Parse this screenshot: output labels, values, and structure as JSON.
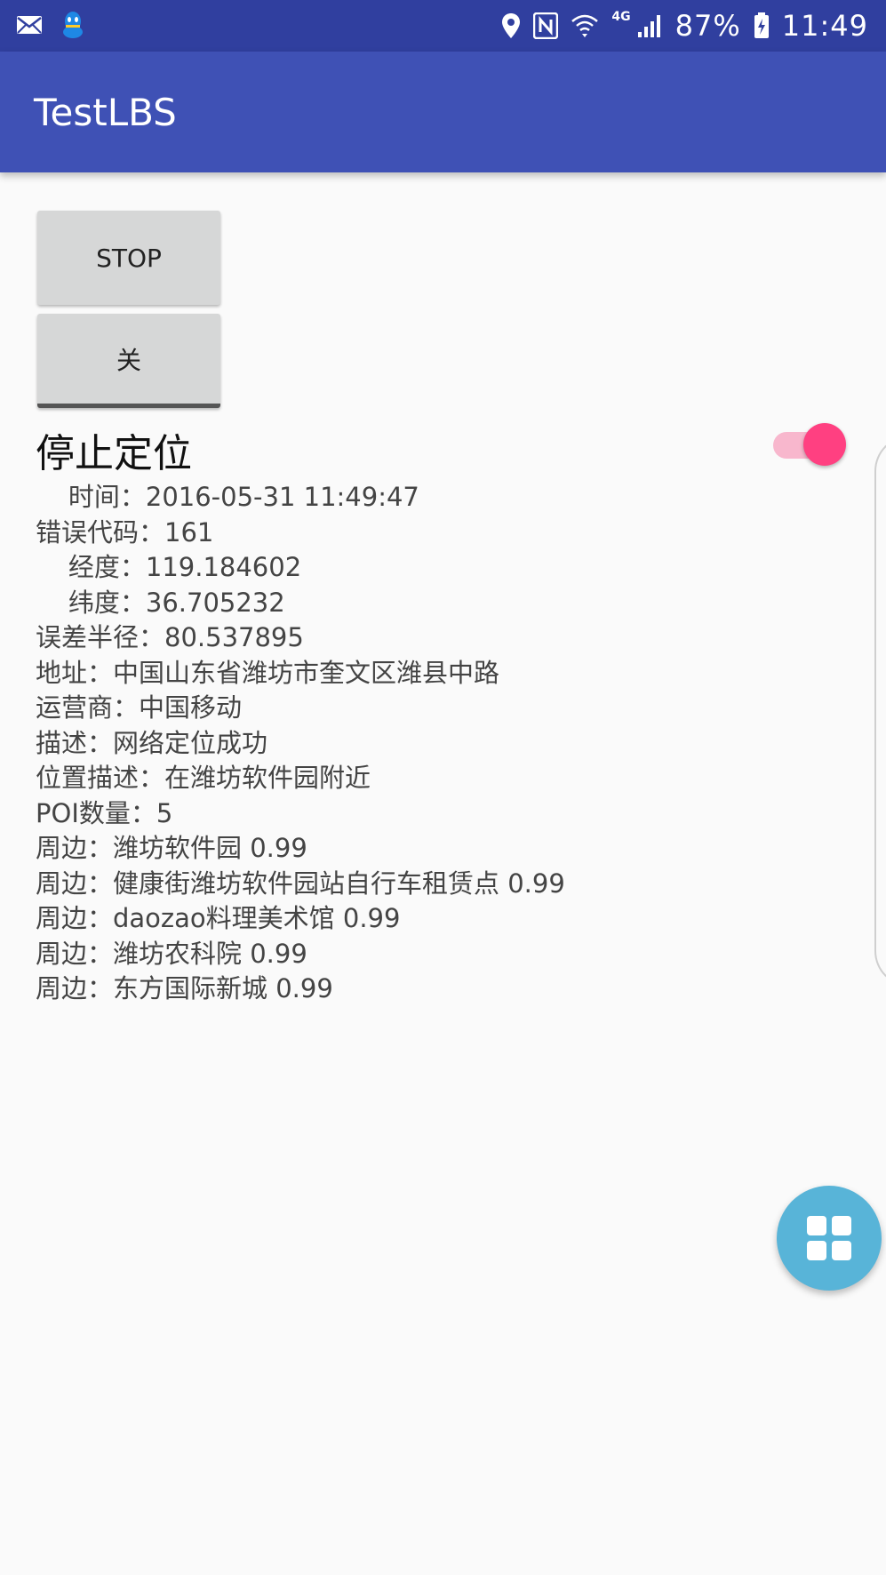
{
  "status_bar": {
    "battery_percent": "87%",
    "time": "11:49",
    "network": "4G",
    "colors": {
      "background": "#303f9f"
    },
    "icons": [
      "mail-icon",
      "qq-icon",
      "location-icon",
      "nfc-icon",
      "wifi-icon",
      "signal-icon",
      "battery-charging-icon"
    ]
  },
  "app_bar": {
    "title": "TestLBS",
    "color": "#3f51b5"
  },
  "buttons": {
    "stop_label": "STOP",
    "off_label": "关"
  },
  "heading": {
    "text": "停止定位"
  },
  "switch": {
    "on": true,
    "color": "#ff4081"
  },
  "location_info": [
    "    时间：2016-05-31 11:49:47",
    "错误代码：161",
    "    经度：119.184602",
    "    纬度：36.705232",
    "误差半径：80.537895",
    "地址：中国山东省潍坊市奎文区潍县中路",
    "运营商：中国移动",
    "描述：网络定位成功",
    "位置描述：在潍坊软件园附近",
    "POI数量：5",
    "周边：潍坊软件园 0.99",
    "周边：健康街潍坊软件园站自行车租赁点 0.99",
    "周边：daozao料理美术馆 0.99",
    "周边：潍坊农科院 0.99",
    "周边：东方国际新城 0.99"
  ],
  "fab": {
    "icon": "apps-grid-icon",
    "color": "#58b4d8"
  }
}
